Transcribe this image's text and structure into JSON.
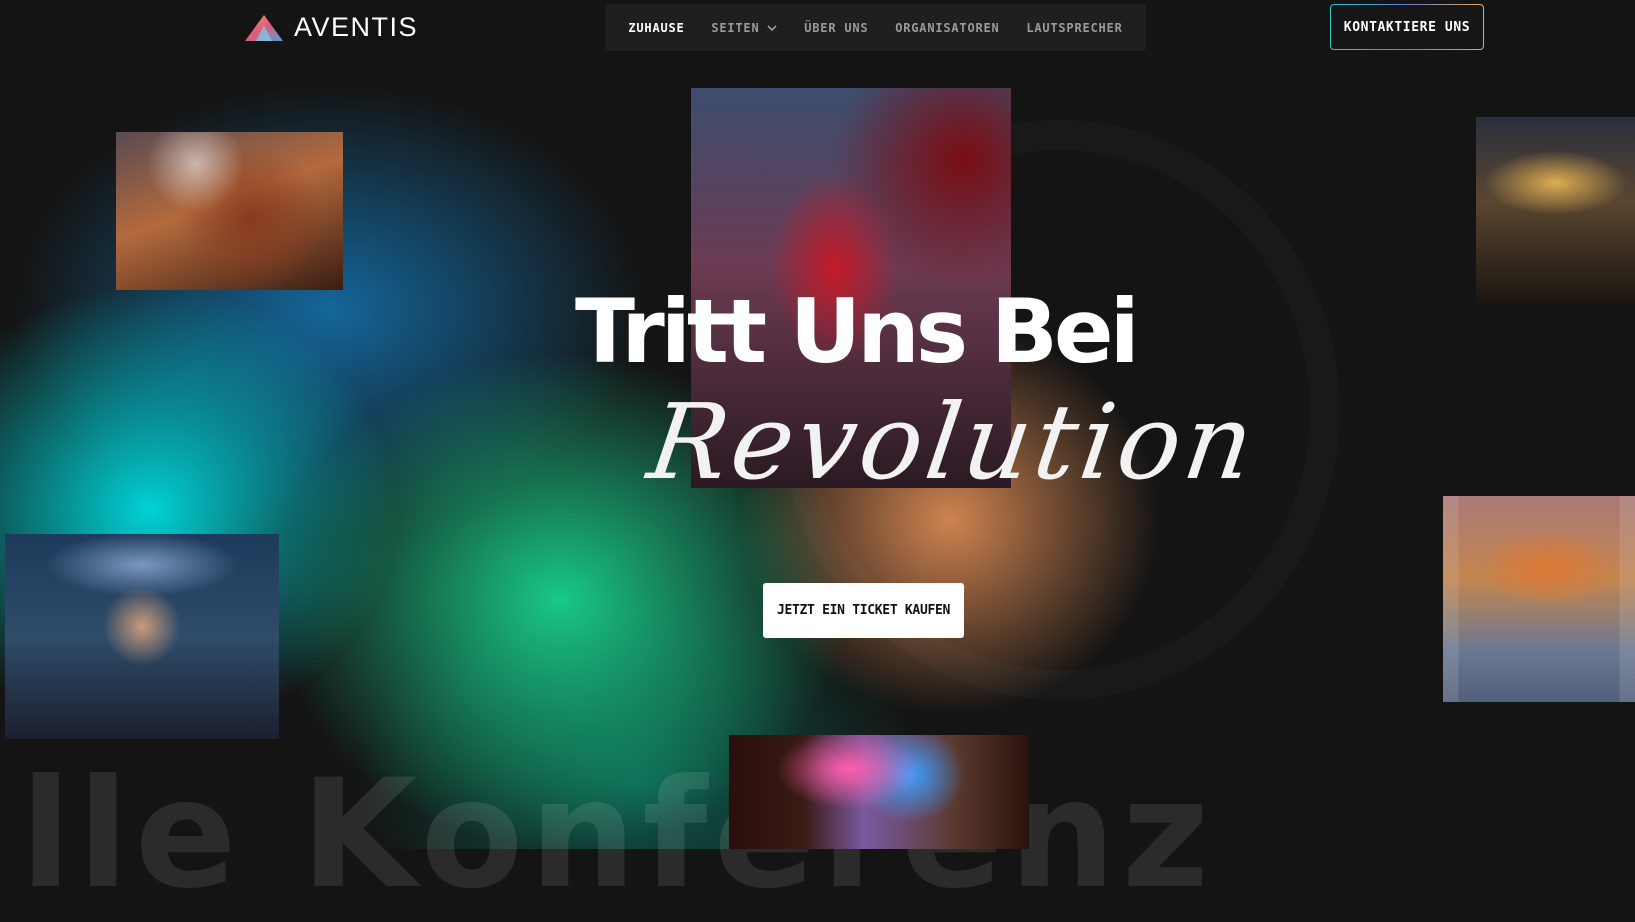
{
  "brand": {
    "name": "AVENTIS"
  },
  "nav": {
    "items": [
      {
        "label": "ZUHAUSE",
        "active": true
      },
      {
        "label": "SEITEN",
        "dropdown": true
      },
      {
        "label": "ÜBER UNS"
      },
      {
        "label": "ORGANISATOREN"
      },
      {
        "label": "LAUTSPRECHER"
      }
    ]
  },
  "header": {
    "contact_label": "KONTAKTIERE UNS"
  },
  "hero": {
    "title": "Tritt Uns Bei",
    "script": "Revolution",
    "cta_label": "JETZT EIN TICKET KAUFEN"
  },
  "background": {
    "marquee": "lle Konferenz"
  },
  "colors": {
    "background": "#141414",
    "nav_bg": "#1f1f1f",
    "accent_teal": "#2ec7c9",
    "accent_orange": "#e3a85a",
    "glow_cyan": "#00dce1",
    "glow_green": "#19d28c"
  },
  "icons": {
    "logo": "triangle-logo-icon",
    "dropdown": "chevron-down-icon"
  }
}
